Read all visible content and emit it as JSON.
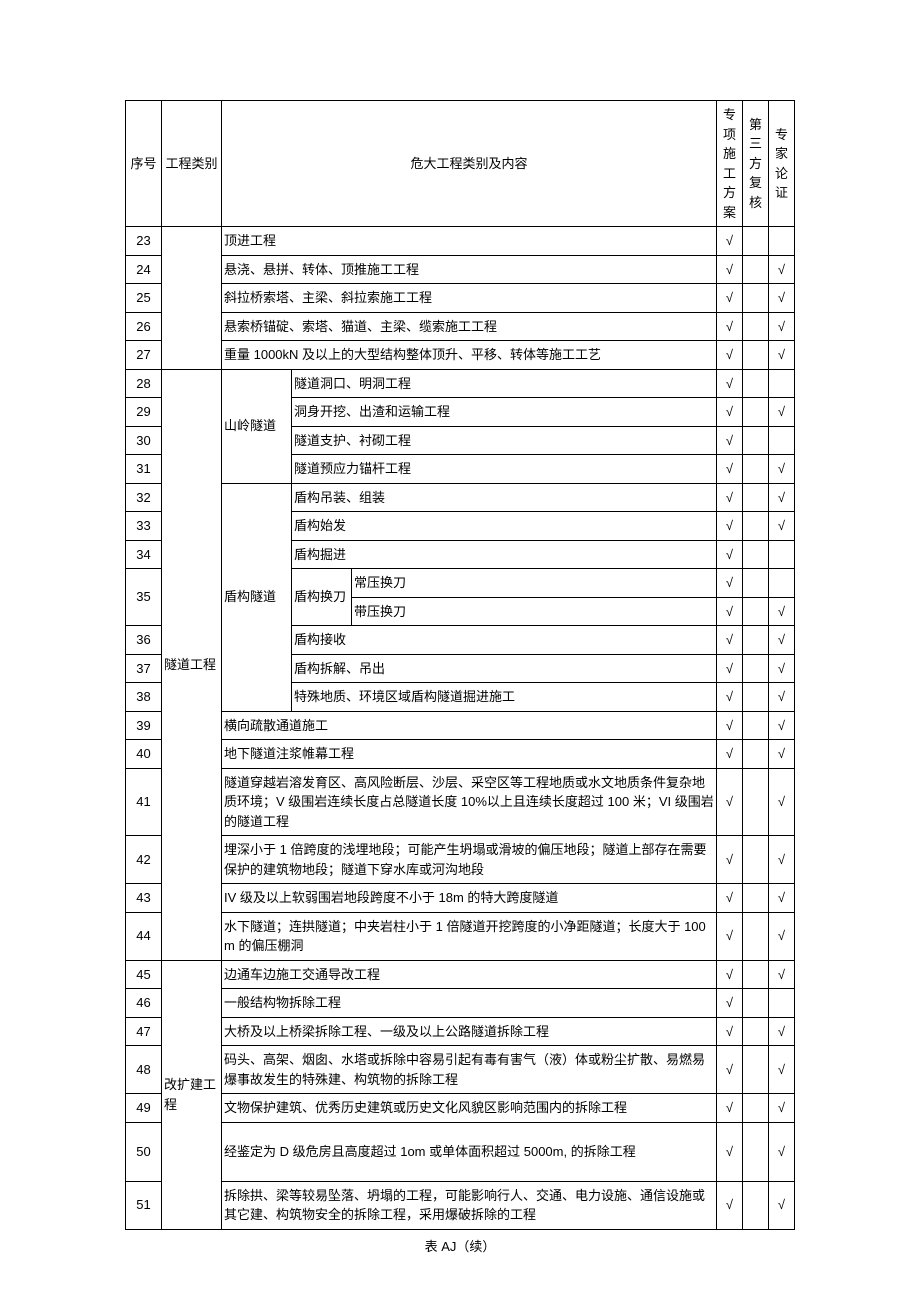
{
  "header": {
    "seq": "序号",
    "cat": "工程类别",
    "content": "危大工程类别及内容",
    "plan": "专项施工方案",
    "review": "第三方复核",
    "expert": "专家论证"
  },
  "check": "√",
  "caption": "表 AJ（续）",
  "rows": [
    {
      "seq": "23",
      "content": "顶进工程",
      "plan": true,
      "review": false,
      "expert": false
    },
    {
      "seq": "24",
      "content": "悬浇、悬拼、转体、顶推施工工程",
      "plan": true,
      "review": false,
      "expert": true
    },
    {
      "seq": "25",
      "content": "斜拉桥索塔、主梁、斜拉索施工工程",
      "plan": true,
      "review": false,
      "expert": true
    },
    {
      "seq": "26",
      "content": "悬索桥锚碇、索塔、猫道、主梁、缆索施工工程",
      "plan": true,
      "review": false,
      "expert": true
    },
    {
      "seq": "27",
      "content": "重量 1000kN 及以上的大型结构整体顶升、平移、转体等施工工艺",
      "plan": true,
      "review": false,
      "expert": true
    }
  ],
  "tunnel": {
    "cat": "隧道工程",
    "mountain": "山岭隧道",
    "shield": "盾构隧道",
    "blade": "盾构换刀",
    "rows28_31": [
      {
        "seq": "28",
        "content": "隧道洞口、明洞工程",
        "plan": true,
        "review": false,
        "expert": false
      },
      {
        "seq": "29",
        "content": "洞身开挖、出渣和运输工程",
        "plan": true,
        "review": false,
        "expert": true
      },
      {
        "seq": "30",
        "content": "隧道支护、衬砌工程",
        "plan": true,
        "review": false,
        "expert": false
      },
      {
        "seq": "31",
        "content": "隧道预应力锚杆工程",
        "plan": true,
        "review": false,
        "expert": true
      }
    ],
    "rows32_34": [
      {
        "seq": "32",
        "content": "盾构吊装、组装",
        "plan": true,
        "review": false,
        "expert": true
      },
      {
        "seq": "33",
        "content": "盾构始发",
        "plan": true,
        "review": false,
        "expert": true
      },
      {
        "seq": "34",
        "content": "盾构掘进",
        "plan": true,
        "review": false,
        "expert": false
      }
    ],
    "row35a": {
      "seq": "35",
      "content": "常压换刀",
      "plan": true,
      "review": false,
      "expert": false
    },
    "row35b": {
      "content": "带压换刀",
      "plan": true,
      "review": false,
      "expert": true
    },
    "rows36_38": [
      {
        "seq": "36",
        "content": "盾构接收",
        "plan": true,
        "review": false,
        "expert": true
      },
      {
        "seq": "37",
        "content": "盾构拆解、吊出",
        "plan": true,
        "review": false,
        "expert": true
      },
      {
        "seq": "38",
        "content": "特殊地质、环境区域盾构隧道掘进施工",
        "plan": true,
        "review": false,
        "expert": true
      }
    ],
    "rows39_44": [
      {
        "seq": "39",
        "content": "横向疏散通道施工",
        "plan": true,
        "review": false,
        "expert": true
      },
      {
        "seq": "40",
        "content": "地下隧道注浆帷幕工程",
        "plan": true,
        "review": false,
        "expert": true
      },
      {
        "seq": "41",
        "content": "隧道穿越岩溶发育区、高风险断层、沙层、采空区等工程地质或水文地质条件复杂地质环境；V 级围岩连续长度占总隧道长度 10%以上且连续长度超过 100 米；VI 级围岩的隧道工程",
        "plan": true,
        "review": false,
        "expert": true
      },
      {
        "seq": "42",
        "content": "埋深小于 1 倍跨度的浅埋地段；可能产生坍塌或滑坡的偏压地段；隧道上部存在需要保护的建筑物地段；隧道下穿水库或河沟地段",
        "plan": true,
        "review": false,
        "expert": true
      },
      {
        "seq": "43",
        "content": "IV 级及以上软弱围岩地段跨度不小于 18m 的特大跨度隧道",
        "plan": true,
        "review": false,
        "expert": true
      },
      {
        "seq": "44",
        "content": "水下隧道；连拱隧道；中夹岩柱小于 1 倍隧道开挖跨度的小净距隧道；长度大于 100m 的偏压棚洞",
        "plan": true,
        "review": false,
        "expert": true
      }
    ]
  },
  "rebuild": {
    "cat": "改扩建工程",
    "rows": [
      {
        "seq": "45",
        "content": "边通车边施工交通导改工程",
        "plan": true,
        "review": false,
        "expert": true
      },
      {
        "seq": "46",
        "content": "一般结构物拆除工程",
        "plan": true,
        "review": false,
        "expert": false
      },
      {
        "seq": "47",
        "content": "大桥及以上桥梁拆除工程、一级及以上公路隧道拆除工程",
        "plan": true,
        "review": false,
        "expert": true
      },
      {
        "seq": "48",
        "content": "码头、高架、烟囱、水塔或拆除中容易引起有毒有害气（液）体或粉尘扩散、易燃易爆事故发生的特殊建、构筑物的拆除工程",
        "plan": true,
        "review": false,
        "expert": true
      },
      {
        "seq": "49",
        "content": "文物保护建筑、优秀历史建筑或历史文化风貌区影响范围内的拆除工程",
        "plan": true,
        "review": false,
        "expert": true
      },
      {
        "seq": "50",
        "content": "经鉴定为 D 级危房且高度超过 1om 或单体面积超过 5000m, 的拆除工程",
        "plan": true,
        "review": false,
        "expert": true
      },
      {
        "seq": "51",
        "content": "拆除拱、梁等较易坠落、坍塌的工程，可能影响行人、交通、电力设施、通信设施或其它建、构筑物安全的拆除工程，采用爆破拆除的工程",
        "plan": true,
        "review": false,
        "expert": true
      }
    ]
  }
}
